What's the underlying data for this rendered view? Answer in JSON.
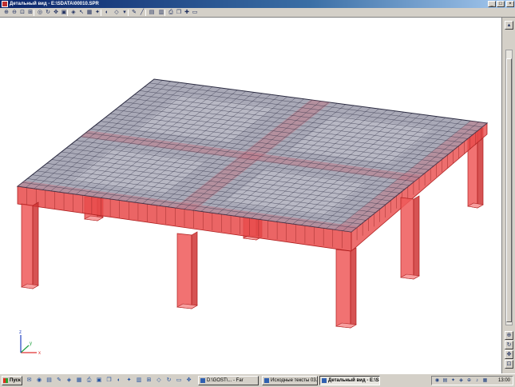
{
  "window": {
    "title": "Детальный вид - E:\\SDATA\\00010.SPR",
    "buttons": {
      "minimize": "_",
      "maximize": "□",
      "close": "×"
    }
  },
  "toolbar": {
    "tools": [
      {
        "name": "zoom-in-icon",
        "glyph": "⊕"
      },
      {
        "name": "zoom-out-icon",
        "glyph": "⊖"
      },
      {
        "name": "zoom-window-icon",
        "glyph": "⊡"
      },
      {
        "name": "zoom-all-icon",
        "glyph": "⊞"
      },
      {
        "name": "zoom-previous-icon",
        "glyph": "◎"
      },
      {
        "name": "rotate-icon",
        "glyph": "↻"
      },
      {
        "name": "pan-icon",
        "glyph": "✥"
      },
      {
        "name": "view-front-icon",
        "glyph": "▣"
      },
      {
        "name": "view-3d-icon",
        "glyph": "◈"
      },
      {
        "name": "select-icon",
        "glyph": "↖"
      },
      {
        "name": "grid-icon",
        "glyph": "▦"
      },
      {
        "name": "light-icon",
        "glyph": "✦"
      },
      {
        "name": "shading-icon",
        "glyph": "◐"
      },
      {
        "name": "wireframe-icon",
        "glyph": "◇"
      },
      {
        "name": "dropdown-icon",
        "glyph": "▾"
      },
      {
        "name": "pencil-icon",
        "glyph": "✎"
      },
      {
        "name": "line-icon",
        "glyph": "╱"
      },
      {
        "name": "color-icon",
        "glyph": "▤"
      },
      {
        "name": "table-icon",
        "glyph": "▥"
      },
      {
        "name": "print-icon",
        "glyph": "⎙"
      },
      {
        "name": "copy-icon",
        "glyph": "❐"
      },
      {
        "name": "graph-icon",
        "glyph": "✚"
      },
      {
        "name": "export-icon",
        "glyph": "▭"
      }
    ]
  },
  "model": {
    "axes": {
      "x": "x",
      "y": "y",
      "z": "z"
    },
    "colors": {
      "slab_top": "#a9a9b7",
      "slab_grid": "#2a2a40",
      "beam": "#e84a4a",
      "column_front": "#ef5959",
      "column_side": "#cf3535",
      "edge": "#b02020",
      "x_axis": "#e03030",
      "y_axis": "#20a040",
      "z_axis": "#2040c0"
    }
  },
  "rightpanel": {
    "buttons": [
      {
        "name": "panel-up-icon",
        "glyph": "▴"
      },
      {
        "name": "panel-zoom-icon",
        "glyph": "⊕"
      },
      {
        "name": "panel-rotate-icon",
        "glyph": "↻"
      },
      {
        "name": "panel-pan-icon",
        "glyph": "✥"
      },
      {
        "name": "panel-fit-icon",
        "glyph": "⊡"
      }
    ]
  },
  "taskbar": {
    "start_label": "Пуск",
    "quicklaunch": [
      "✉",
      "◉",
      "▤",
      "✎",
      "◈",
      "▦",
      "⎙",
      "▣",
      "❐",
      "◐",
      "✦",
      "▥",
      "⊞",
      "◇",
      "↻",
      "▭",
      "✥"
    ],
    "tasks": [
      {
        "label": "D:\\GOST\\... - Far",
        "active": false
      },
      {
        "label": "Исходные тексты 03.d...",
        "active": false
      },
      {
        "label": "Детальный вид - E:\\S...",
        "active": true
      }
    ],
    "tray_icons": [
      "◉",
      "▤",
      "✦",
      "◈",
      "⊕",
      "♪",
      "▦"
    ],
    "clock": "13:00"
  }
}
